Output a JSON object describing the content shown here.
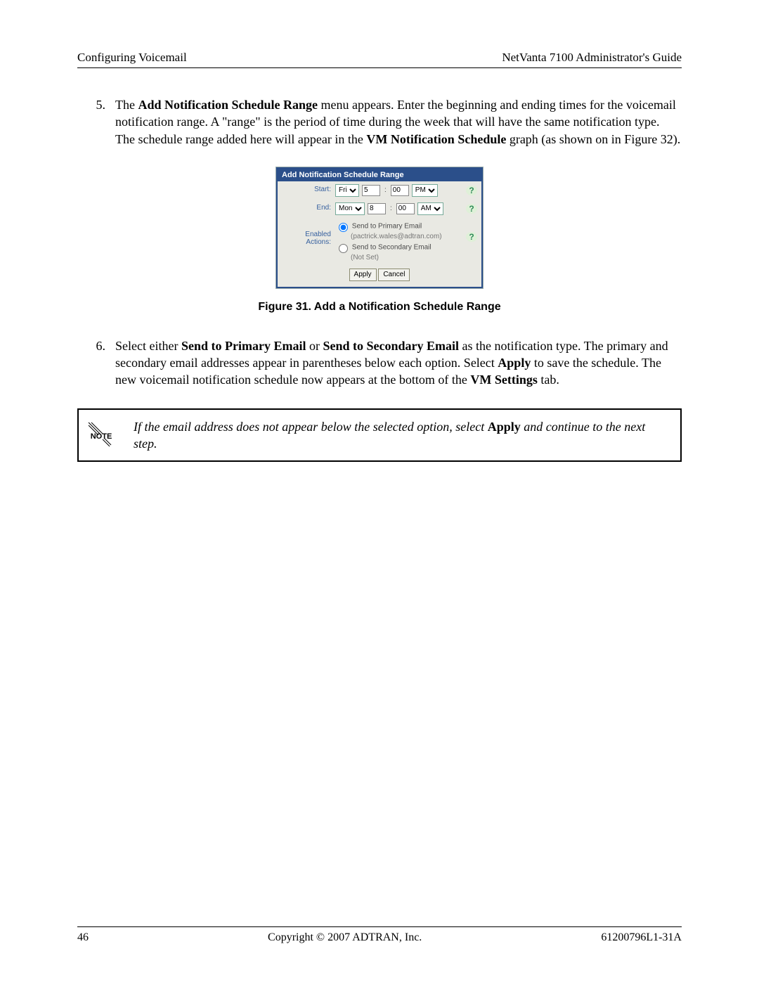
{
  "header": {
    "left": "Configuring Voicemail",
    "right": "NetVanta 7100 Administrator's Guide"
  },
  "steps": [
    {
      "num": "5.",
      "before": "The ",
      "bold1": "Add Notification Schedule Range",
      "mid1": " menu appears. Enter the beginning and ending times for the voicemail notification range. A \"range\" is the period of time during the week that will have the same notification type. The schedule range added here will appear in the ",
      "bold2": "VM Notification Schedule",
      "after": " graph (as shown on in Figure 32)."
    },
    {
      "num": "6.",
      "before": "Select either ",
      "bold1": "Send to Primary Email",
      "mid1": " or ",
      "bold2": "Send to Secondary Email",
      "mid2": " as the notification type. The primary and secondary email addresses appear in parentheses below each option. Select ",
      "bold3": "Apply",
      "mid3": " to save the schedule. The new voicemail notification schedule now appears at the bottom of the ",
      "bold4": "VM Settings",
      "after": " tab."
    }
  ],
  "dialog": {
    "title": "Add Notification Schedule Range",
    "start_label": "Start:",
    "end_label": "End:",
    "actions_label": "Enabled Actions:",
    "start_day": "Fri",
    "start_hour": "5",
    "start_min": "00",
    "start_ampm": "PM",
    "end_day": "Mon",
    "end_hour": "8",
    "end_min": "00",
    "end_ampm": "AM",
    "opt1_label": "Send to Primary Email",
    "opt1_sub": "(pactrick.wales@adtran.com)",
    "opt2_label": "Send to Secondary Email",
    "opt2_sub": "(Not Set)",
    "apply": "Apply",
    "cancel": "Cancel",
    "help": "?"
  },
  "caption": "Figure 31.  Add a Notification Schedule Range",
  "note": {
    "before": "If the email address does not appear below the selected option, select ",
    "bold": "Apply",
    "after": " and continue to the next step.",
    "icon_text": "NOTE"
  },
  "footer": {
    "left": "46",
    "center": "Copyright © 2007 ADTRAN, Inc.",
    "right": "61200796L1-31A"
  }
}
